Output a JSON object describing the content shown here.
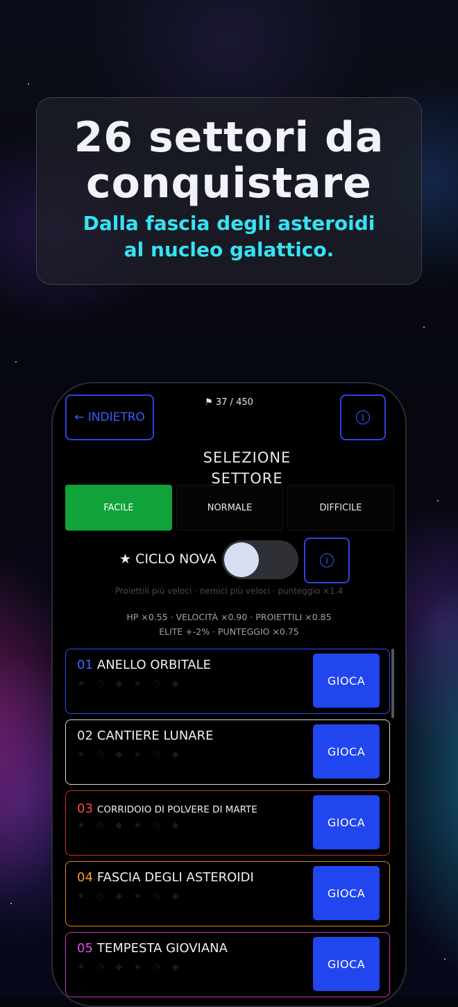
{
  "promo": {
    "title": "26 settori da conquistare",
    "subtitle_line1": "Dalla fascia degli asteroidi",
    "subtitle_line2": "al nucleo galattico."
  },
  "header": {
    "back_label": "← INDIETRO",
    "progress": "⚑ 37 / 450",
    "info_icon": "i",
    "title_line1": "SELEZIONE",
    "title_line2": "SETTORE"
  },
  "difficulty_tabs": [
    {
      "label": "FACILE",
      "active": true
    },
    {
      "label": "NORMALE",
      "active": false
    },
    {
      "label": "DIFFICILE",
      "active": false
    }
  ],
  "nova": {
    "label": "★ CICLO NOVA",
    "enabled": false,
    "info_icon": "i",
    "hint": "Proiettili più veloci · nemici più veloci · punteggio ×1.4"
  },
  "modifiers": {
    "line1": "HP ×0.55   ·   VELOCITÀ ×0.90   ·   PROIETTILI ×0.85",
    "line2": "ELITE +-2%   ·   PUNTEGGIO ×0.75"
  },
  "levels": [
    {
      "num": "01",
      "name": "ANELLO ORBITALE",
      "color": "#2f4fff",
      "num_color": "#3b6bff",
      "rating": "★ ◷ ◆ ★ ◷ ◆",
      "play": "GIOCA"
    },
    {
      "num": "02",
      "name": "CANTIERE LUNARE",
      "color": "#d8d8d8",
      "num_color": "#e6e6e6",
      "rating": "★ ◷ ◆ ★ ◷ ◆",
      "play": "GIOCA"
    },
    {
      "num": "03",
      "name": "CORRIDOIO DI POLVERE DI MARTE",
      "color": "#c8352a",
      "num_color": "#ff4a3a",
      "rating": "★ ◷ ◆ ★ ◷ ◆",
      "play": "GIOCA"
    },
    {
      "num": "04",
      "name": "FASCIA DEGLI ASTEROIDI",
      "color": "#d98a1f",
      "num_color": "#f5a02a",
      "rating": "★ ◷ ◆ ★ ◷ ◆",
      "play": "GIOCA"
    },
    {
      "num": "05",
      "name": "TEMPESTA GIOVIANA",
      "color": "#c236c8",
      "num_color": "#e14ae8",
      "rating": "★ ◷ ◆ ★ ◷ ◆",
      "play": "GIOCA"
    }
  ]
}
